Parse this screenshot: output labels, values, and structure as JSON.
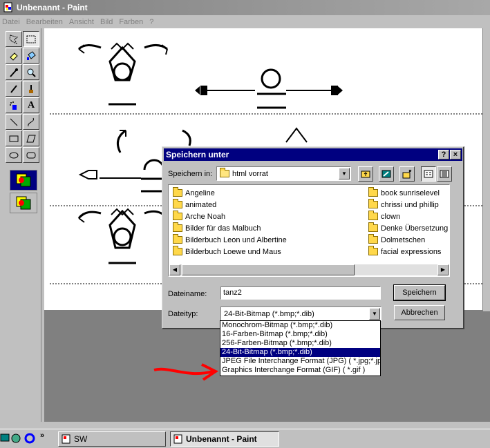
{
  "window": {
    "title": "Unbenannt - Paint"
  },
  "menu": [
    "Datei",
    "Bearbeiten",
    "Ansicht",
    "Bild",
    "Farben",
    "?"
  ],
  "toolbox": {
    "tools": [
      "free-select",
      "rect-select",
      "eraser",
      "fill",
      "color-picker",
      "magnifier",
      "pencil",
      "brush",
      "airbrush",
      "text",
      "line",
      "curve",
      "rectangle",
      "polygon",
      "ellipse",
      "rounded-rectangle"
    ],
    "text_tool_glyph": "A"
  },
  "dialog": {
    "title": "Speichern unter",
    "help_btn": "?",
    "close_btn": "×",
    "save_in_label": "Speichern in:",
    "save_in_value": "html vorrat",
    "folders_left": [
      "Angeline",
      "animated",
      "Arche Noah",
      "Bilder für das Malbuch",
      "Bilderbuch Leon und Albertine",
      "Bilderbuch Loewe und Maus"
    ],
    "folders_right": [
      "book sunriselevel",
      "chrissi und phillip",
      "clown",
      "Denke Übersetzung",
      "Dolmetschen",
      "facial expressions"
    ],
    "filename_label": "Dateiname:",
    "filename_value": "tanz2",
    "filetype_label": "Dateityp:",
    "filetype_value": "24-Bit-Bitmap (*.bmp;*.dib)",
    "save_button": "Speichern",
    "cancel_button": "Abbrechen",
    "filetype_options": [
      "Monochrom-Bitmap (*.bmp;*.dib)",
      "16-Farben-Bitmap (*.bmp;*.dib)",
      "256-Farben-Bitmap (*.bmp;*.dib)",
      "24-Bit-Bitmap (*.bmp;*.dib)",
      "JPEG File Interchange Format (JPG) ( *.jpg;*.jpeg)",
      "Graphics Interchange Format (GIF) ( *.gif )"
    ],
    "selected_option_index": 3
  },
  "taskbar": {
    "items": [
      {
        "label": "SW",
        "active": false
      },
      {
        "label": "Unbenannt - Paint",
        "active": true
      }
    ],
    "chevron": "»"
  },
  "colors": {
    "title_active": "#000080",
    "title_inactive": "#808080",
    "annotation_arrow": "#ff0000",
    "folder": "#ffd84a"
  }
}
